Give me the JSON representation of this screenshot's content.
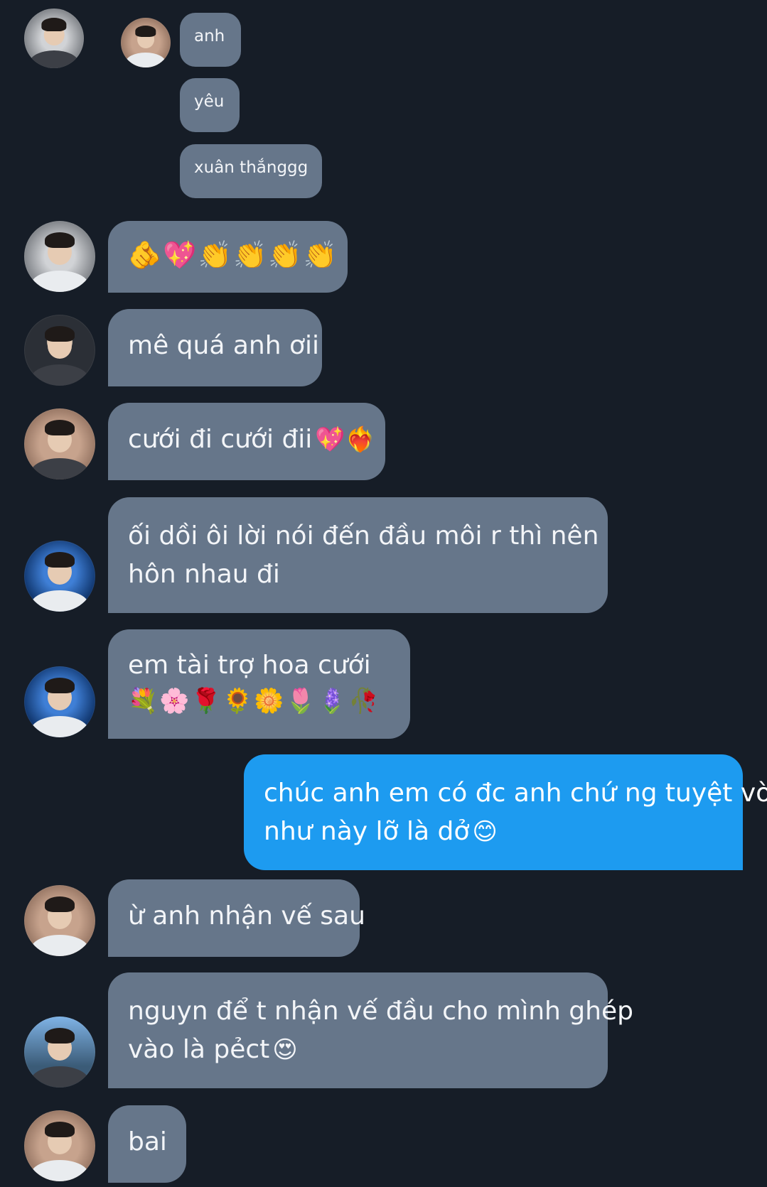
{
  "messages": [
    {
      "text": "anh"
    },
    {
      "text": "yêu"
    },
    {
      "text": "xuân thắnggg"
    },
    {
      "text": "🫵💖👏👏👏👏"
    },
    {
      "text": "mê quá anh ơii"
    },
    {
      "text": "cưới đi cưới đii",
      "emoji": "💖❤️‍🔥"
    },
    {
      "line1": "ối dồi ôi lời nói đến đầu môi r thì nên",
      "line2": "hôn nhau đi"
    },
    {
      "line1": "em tài trợ hoa cưới",
      "line2": "💐🌸🌹🌻🌼🌷🪻🥀"
    },
    {
      "line1": "chúc anh em có đc anh chứ ng tuyệt vời",
      "line2": "như này lỡ là dở",
      "emoji": "😊"
    },
    {
      "text": "ừ anh nhận vế sau"
    },
    {
      "line1": "nguyn để t nhận vế đầu cho mình ghép",
      "line2": "vào là pẻct",
      "emoji": "😍"
    },
    {
      "text": "bai"
    }
  ]
}
